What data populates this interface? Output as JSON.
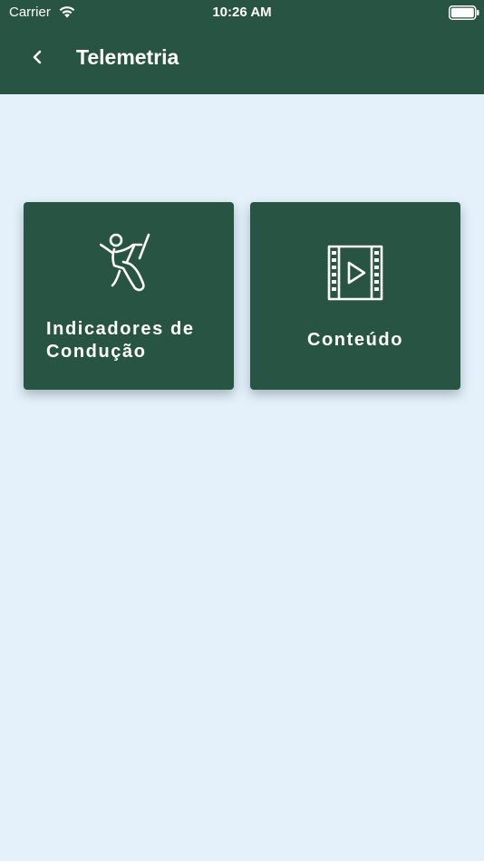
{
  "status_bar": {
    "carrier": "Carrier",
    "time": "10:26 AM",
    "icons": [
      "wifi-icon",
      "battery-icon"
    ]
  },
  "header": {
    "title": "Telemetria",
    "back_icon": "chevron-left-icon"
  },
  "cards": [
    {
      "label": "Indicadores de\nCondução",
      "icon": "driver-seat-icon"
    },
    {
      "label": "Conteúdo",
      "icon": "video-film-icon"
    }
  ],
  "colors": {
    "primary": "#285543",
    "background": "#e4f1fb",
    "text_on_primary": "#ffffff"
  }
}
